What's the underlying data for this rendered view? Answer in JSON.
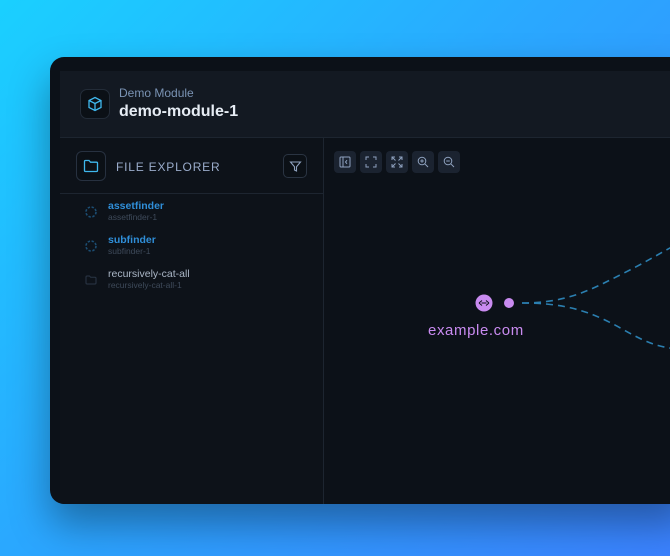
{
  "header": {
    "module_type": "Demo Module",
    "module_name": "demo-module-1",
    "icon": "cube-icon"
  },
  "explorer": {
    "title": "FILE EXPLORER",
    "folder_icon": "folder-icon",
    "filter_icon": "filter-icon",
    "items": [
      {
        "name": "assetfinder",
        "id": "assetfinder-1",
        "status": "running",
        "color": "#2f8ed8"
      },
      {
        "name": "subfinder",
        "id": "subfinder-1",
        "status": "running",
        "color": "#2f8ed8"
      },
      {
        "name": "recursively-cat-all",
        "id": "recursively-cat-all-1",
        "status": "idle",
        "color": "#aab6c6"
      }
    ]
  },
  "toolbar": {
    "buttons": [
      "toggle-sidebar-icon",
      "fit-view-icon",
      "fullscreen-icon",
      "zoom-in-icon",
      "zoom-out-icon"
    ]
  },
  "graph": {
    "root_node": "example.com",
    "node_color": "#c98bf0",
    "edge_color": "#2b7fb0"
  },
  "colors": {
    "accent": "#2f8ed8",
    "node": "#c98bf0"
  }
}
